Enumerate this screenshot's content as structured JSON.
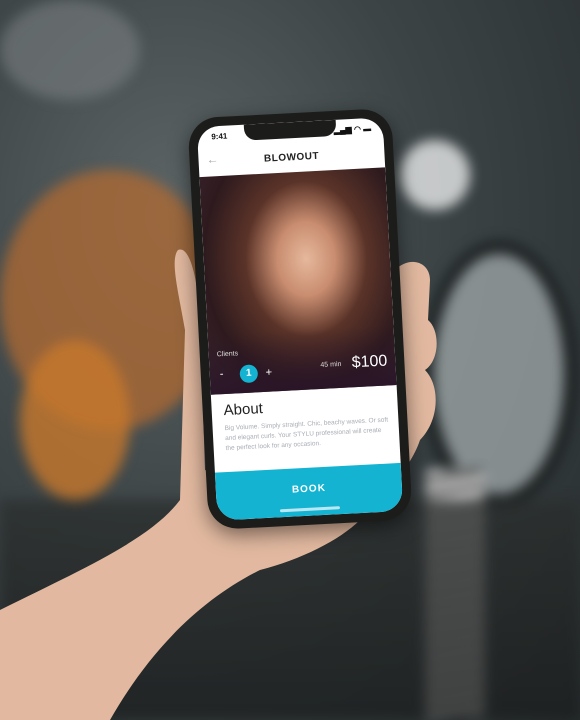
{
  "status_bar": {
    "time": "9:41",
    "icons": [
      "signal-icon",
      "wifi-icon",
      "battery-icon"
    ]
  },
  "header": {
    "title": "BLOWOUT",
    "back_icon": "arrow-left-icon"
  },
  "service": {
    "clients_label": "Clients",
    "clients_count": "1",
    "minus_label": "-",
    "plus_label": "+",
    "duration": "45 min",
    "price": "$100"
  },
  "about": {
    "heading": "About",
    "description": "Big Volume. Simply straight. Chic, beachy waves. Or soft and elegant curls. Your STYLU professional will create the perfect look for any occasion."
  },
  "book_button": {
    "label": "BOOK"
  },
  "colors": {
    "accent": "#14b3d2"
  }
}
